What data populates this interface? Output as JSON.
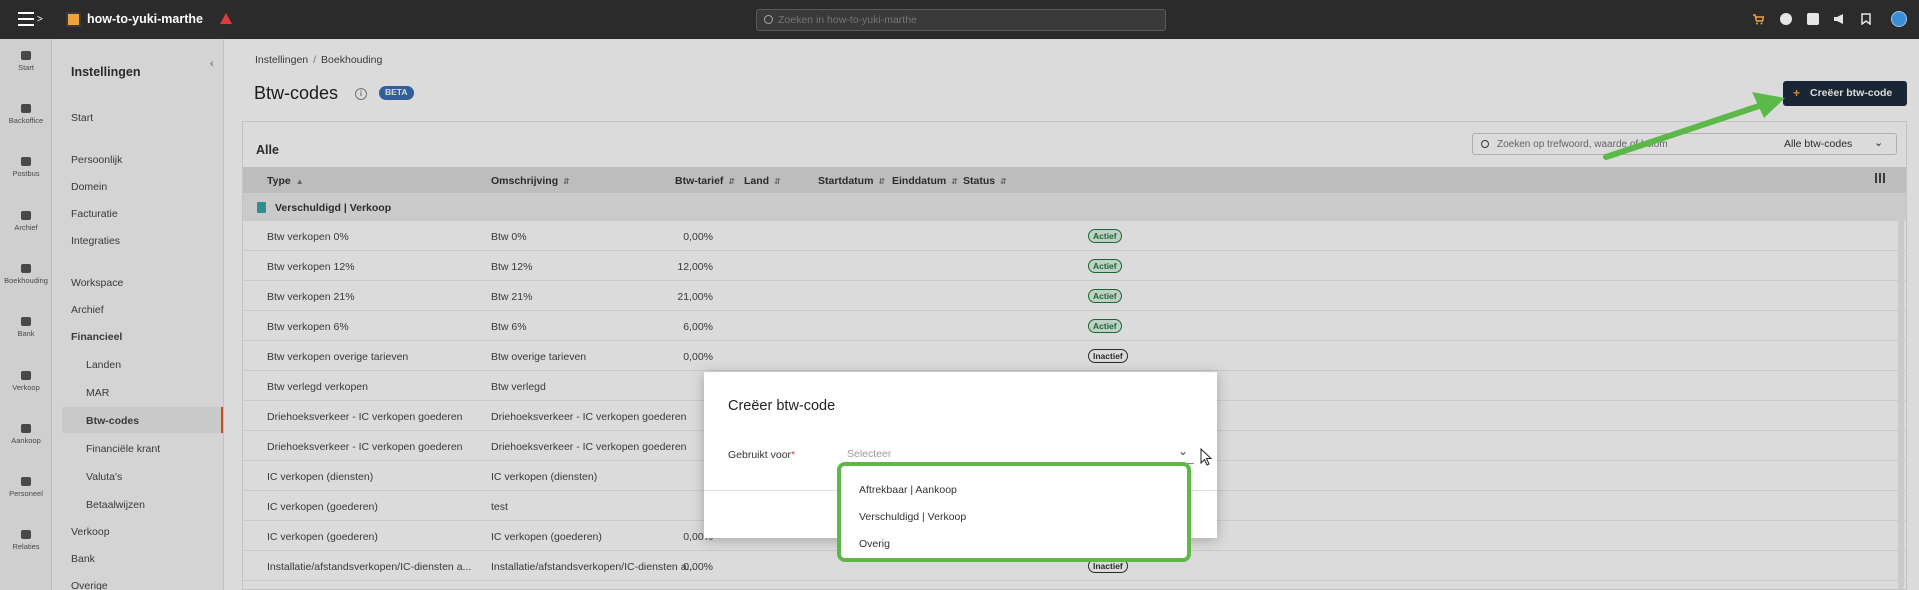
{
  "topbar": {
    "admin_name": "how-to-yuki-marthe",
    "search_placeholder": "Zoeken in how-to-yuki-marthe"
  },
  "rail": [
    {
      "label": "Start",
      "icon": "home-icon"
    },
    {
      "label": "Backoffice",
      "icon": "backoffice-icon"
    },
    {
      "label": "Postbus",
      "icon": "inbox-icon"
    },
    {
      "label": "Archief",
      "icon": "archive-icon"
    },
    {
      "label": "Boekhouding",
      "icon": "chart-icon"
    },
    {
      "label": "Bank",
      "icon": "bank-icon"
    },
    {
      "label": "Verkoop",
      "icon": "sales-icon"
    },
    {
      "label": "Aankoop",
      "icon": "truck-icon"
    },
    {
      "label": "Personeel",
      "icon": "people-icon"
    },
    {
      "label": "Relaties",
      "icon": "relations-icon"
    }
  ],
  "sidebar": {
    "title": "Instellingen",
    "items": [
      {
        "label": "Start"
      },
      {
        "label": "Persoonlijk"
      },
      {
        "label": "Domein"
      },
      {
        "label": "Facturatie"
      },
      {
        "label": "Integraties"
      },
      {
        "label": "Workspace"
      },
      {
        "label": "Archief"
      },
      {
        "label": "Financieel"
      },
      {
        "label": "Landen"
      },
      {
        "label": "MAR"
      },
      {
        "label": "Btw-codes"
      },
      {
        "label": "Financiële krant"
      },
      {
        "label": "Valuta's"
      },
      {
        "label": "Betaalwijzen"
      },
      {
        "label": "Verkoop"
      },
      {
        "label": "Bank"
      },
      {
        "label": "Overige"
      }
    ]
  },
  "breadcrumb": {
    "parent": "Instellingen",
    "sep": "/",
    "current": "Boekhouding"
  },
  "page": {
    "title": "Btw-codes",
    "beta": "BETA",
    "create_label": "Creëer btw-code"
  },
  "card": {
    "title": "Alle",
    "search_placeholder": "Zoeken op trefwoord, waarde of kolom",
    "filter_label": "Alle btw-codes"
  },
  "table": {
    "headers": [
      "Type",
      "Omschrijving",
      "Btw-tarief",
      "Land",
      "Startdatum",
      "Einddatum",
      "Status"
    ],
    "group": "Verschuldigd | Verkoop",
    "rows": [
      {
        "type": "Btw verkopen 0%",
        "desc": "Btw 0%",
        "rate": "0,00%",
        "status": "Actief"
      },
      {
        "type": "Btw verkopen 12%",
        "desc": "Btw 12%",
        "rate": "12,00%",
        "status": "Actief"
      },
      {
        "type": "Btw verkopen 21%",
        "desc": "Btw 21%",
        "rate": "21,00%",
        "status": "Actief"
      },
      {
        "type": "Btw verkopen 6%",
        "desc": "Btw 6%",
        "rate": "6,00%",
        "status": "Actief"
      },
      {
        "type": "Btw verkopen overige tarieven",
        "desc": "Btw overige tarieven",
        "rate": "0,00%",
        "status": "Inactief"
      },
      {
        "type": "Btw verlegd verkopen",
        "desc": "Btw verlegd",
        "rate": "",
        "status": ""
      },
      {
        "type": "Driehoeksverkeer - IC verkopen goederen",
        "desc": "Driehoeksverkeer - IC verkopen goederen",
        "rate": "",
        "status": ""
      },
      {
        "type": "Driehoeksverkeer - IC verkopen goederen",
        "desc": "Driehoeksverkeer - IC verkopen goederen",
        "rate": "",
        "status": ""
      },
      {
        "type": "IC verkopen (diensten)",
        "desc": "IC verkopen (diensten)",
        "rate": "",
        "status": ""
      },
      {
        "type": "IC verkopen (goederen)",
        "desc": "test",
        "rate": "",
        "status": ""
      },
      {
        "type": "IC verkopen (goederen)",
        "desc": "IC verkopen (goederen)",
        "rate": "0,00%",
        "status": ""
      },
      {
        "type": "Installatie/afstandsverkopen/IC-diensten a...",
        "desc": "Installatie/afstandsverkopen/IC-diensten a...",
        "rate": "0,00%",
        "status": "Inactief"
      }
    ]
  },
  "modal": {
    "title": "Creëer btw-code",
    "field_label": "Gebruikt voor",
    "required_mark": "*",
    "select_placeholder": "Selecteer",
    "options": [
      "Aftrekbaar | Aankoop",
      "Verschuldigd | Verkoop",
      "Overig"
    ]
  },
  "colors": {
    "topbar": "#2b2b2b",
    "primary_button": "#1f2d3d",
    "accent": "#e05a2b",
    "highlight": "#5db84a",
    "active_badge": "#1d7a3a"
  }
}
